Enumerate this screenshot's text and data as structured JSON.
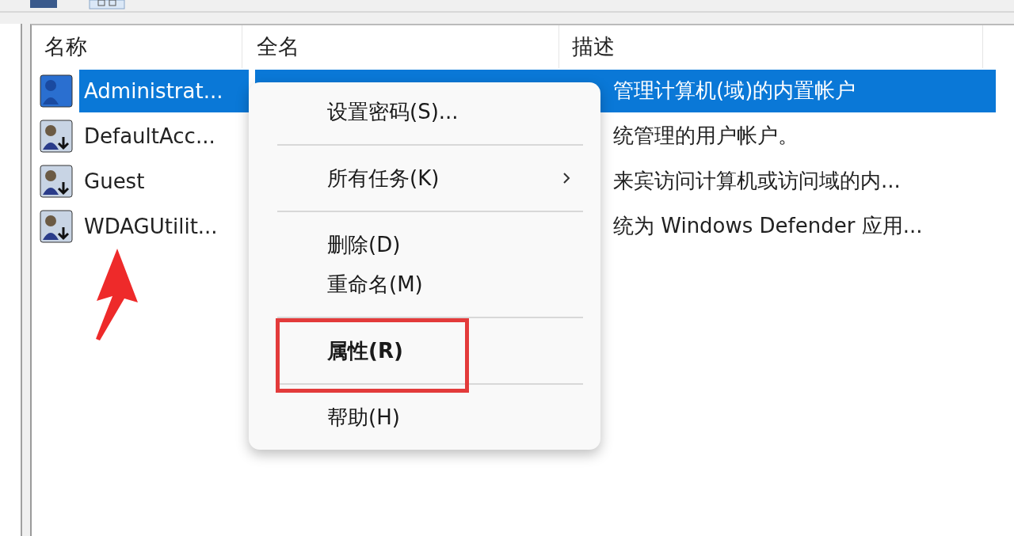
{
  "table": {
    "columns": [
      "名称",
      "全名",
      "描述"
    ],
    "rows": [
      {
        "name": "Administrat...",
        "description": "管理计算机(域)的内置帐户",
        "selected": true
      },
      {
        "name": "DefaultAcc...",
        "description": "统管理的用户帐户。",
        "selected": false
      },
      {
        "name": "Guest",
        "description": "来宾访问计算机或访问域的内...",
        "selected": false
      },
      {
        "name": "WDAGUtilit...",
        "description": "统为 Windows Defender 应用...",
        "selected": false
      }
    ]
  },
  "context_menu": {
    "items": [
      {
        "kind": "item",
        "label": "设置密码(S)...",
        "submenu": false,
        "bold": false,
        "highlighted": false
      },
      {
        "kind": "separator"
      },
      {
        "kind": "item",
        "label": "所有任务(K)",
        "submenu": true,
        "bold": false,
        "highlighted": false
      },
      {
        "kind": "separator"
      },
      {
        "kind": "item",
        "label": "删除(D)",
        "submenu": false,
        "bold": false,
        "highlighted": false
      },
      {
        "kind": "item",
        "label": "重命名(M)",
        "submenu": false,
        "bold": false,
        "highlighted": false
      },
      {
        "kind": "separator"
      },
      {
        "kind": "item",
        "label": "属性(R)",
        "submenu": false,
        "bold": true,
        "highlighted": true
      },
      {
        "kind": "separator"
      },
      {
        "kind": "item",
        "label": "帮助(H)",
        "submenu": false,
        "bold": false,
        "highlighted": false
      }
    ]
  }
}
